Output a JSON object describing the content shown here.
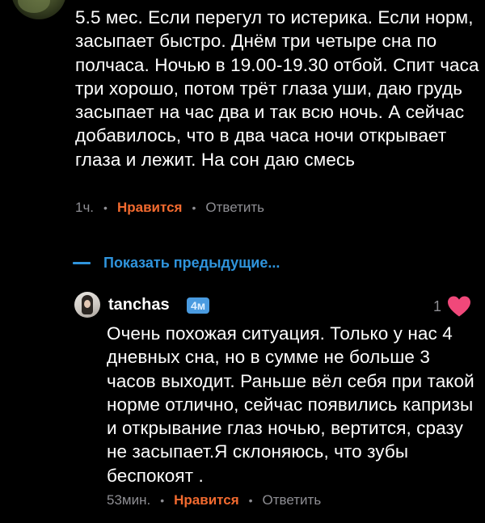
{
  "comment_top": {
    "text": "5.5 мес. Если перегул то истерика.  Если норм, засыпает быстро. Днём три четыре сна по полчаса. Ночью в 19.00-19.30 отбой. Спит часа три хорошо, потом трёт глаза уши, даю грудь засыпает на час два и так всю ночь. А сейчас добавилось, что в два часа ночи открывает глаза и лежит. На сон даю смесь",
    "time": "1ч.",
    "like_label": "Нравится",
    "reply_label": "Ответить"
  },
  "show_previous": {
    "label": "Показать предыдущие..."
  },
  "comment_reply": {
    "username": "tanchas",
    "age_badge": "4м",
    "like_count": "1",
    "text": "Очень похожая ситуация. Только у нас 4 дневных сна, но в сумме не больше 3 часов выходит. Раньше вёл себя при такой норме отлично, сейчас появились капризы и открывание глаз ночью, вертится, сразу не засыпает.Я склоняюсь, что зубы беспокоят .",
    "time": "53мин.",
    "like_label": "Нравится",
    "reply_label": "Ответить"
  },
  "separator": "•",
  "colors": {
    "background": "#000000",
    "text": "#ffffff",
    "meta": "#8e8e93",
    "like_accent": "#f26a2f",
    "link": "#2f94dc",
    "badge": "#4a9be0",
    "heart": "#f0487a"
  },
  "icons": {
    "heart": "heart-icon",
    "dash": "dash-icon"
  }
}
